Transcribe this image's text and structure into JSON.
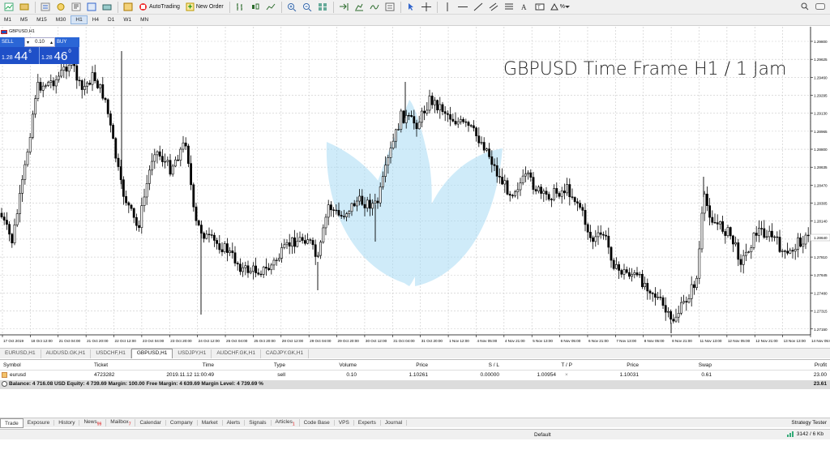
{
  "toolbar": {
    "autotrading_label": "AutoTrading",
    "new_order_label": "New Order",
    "zoom_value": "%"
  },
  "timeframes": [
    "M1",
    "M5",
    "M15",
    "M30",
    "H1",
    "H4",
    "D1",
    "W1",
    "MN"
  ],
  "active_timeframe": "H1",
  "chart": {
    "window_label": "GBPUSD,H1",
    "overlay_title": "GBPUSD Time Frame H1 / 1 Jam",
    "price_ticks": [
      "1.29800",
      "1.29625",
      "1.29460",
      "1.29295",
      "1.29130",
      "1.28965",
      "1.28800",
      "1.28635",
      "1.28470",
      "1.28305",
      "1.28140",
      "1.27975",
      "1.27810",
      "1.27645",
      "1.27480",
      "1.27315",
      "1.27150"
    ],
    "current_price_label": "1.28640",
    "time_ticks": [
      "17 Oct 2019",
      "18 Oct 12:00",
      "21 Oct 04:00",
      "21 Oct 20:00",
      "22 Oct 12:00",
      "23 Oct 04:00",
      "23 Oct 20:00",
      "24 Oct 12:00",
      "25 Oct 04:00",
      "25 Oct 20:00",
      "28 Oct 12:00",
      "29 Oct 04:00",
      "29 Oct 20:00",
      "30 Oct 12:00",
      "31 Oct 04:00",
      "31 Oct 20:00",
      "1 Nov 12:00",
      "4 Nov 05:00",
      "4 Nov 21:00",
      "5 Nov 13:00",
      "6 Nov 05:00",
      "6 Nov 21:00",
      "7 Nov 13:00",
      "8 Nov 05:00",
      "8 Nov 21:00",
      "11 Nov 13:00",
      "12 Nov 05:00",
      "12 Nov 21:00",
      "13 Nov 13:00",
      "14 Nov 05:00"
    ],
    "colors": {
      "candles": "#000000",
      "grid": "#c9c9c9",
      "leaf": "#a8dcf5"
    }
  },
  "trade_panel": {
    "sell_label": "SELL",
    "buy_label": "BUY",
    "lot": "0.10",
    "sell_prefix": "1.28",
    "sell_big": "44",
    "sell_sup": "6",
    "buy_prefix": "1.28",
    "buy_big": "46",
    "buy_sup": "0"
  },
  "chart_tabs": [
    "EURUSD,H1",
    "AUDUSD.GK,H1",
    "USDCHF,H1",
    "GBPUSD,H1",
    "USDJPY,H1",
    "AUDCHF.GK,H1",
    "CADJPY.GK,H1"
  ],
  "active_chart_tab": "GBPUSD,H1",
  "terminal": {
    "headers": {
      "symbol": "Symbol",
      "ticket": "Ticket",
      "time": "Time",
      "type": "Type",
      "volume": "Volume",
      "price": "Price",
      "sl": "S / L",
      "tp": "T / P",
      "price2": "Price",
      "swap": "Swap",
      "profit": "Profit"
    },
    "row": {
      "symbol": "eurusd",
      "ticket": "4723282",
      "time": "2019.11.12 11:00:49",
      "type": "sell",
      "volume": "0.10",
      "price": "1.10261",
      "sl": "0.00000",
      "tp": "1.00954",
      "price2": "1.10031",
      "swap": "0.61",
      "profit": "23.00"
    },
    "balance_text": "Balance: 4 716.08 USD  Equity: 4 739.69  Margin: 100.00  Free Margin: 4 639.69  Margin Level: 4 739.69 %",
    "balance_profit": "23.61"
  },
  "terminal_tabs": [
    {
      "label": "Trade",
      "badge": ""
    },
    {
      "label": "Exposure",
      "badge": ""
    },
    {
      "label": "History",
      "badge": ""
    },
    {
      "label": "News",
      "badge": "99"
    },
    {
      "label": "Mailbox",
      "badge": "7"
    },
    {
      "label": "Calendar",
      "badge": ""
    },
    {
      "label": "Company",
      "badge": ""
    },
    {
      "label": "Market",
      "badge": ""
    },
    {
      "label": "Alerts",
      "badge": ""
    },
    {
      "label": "Signals",
      "badge": ""
    },
    {
      "label": "Articles",
      "badge": "1"
    },
    {
      "label": "Code Base",
      "badge": ""
    },
    {
      "label": "VPS",
      "badge": ""
    },
    {
      "label": "Experts",
      "badge": ""
    },
    {
      "label": "Journal",
      "badge": ""
    }
  ],
  "strategy_tester_label": "Strategy Tester",
  "status": {
    "profile": "Default",
    "connection": "3142 / 6 Kb"
  }
}
